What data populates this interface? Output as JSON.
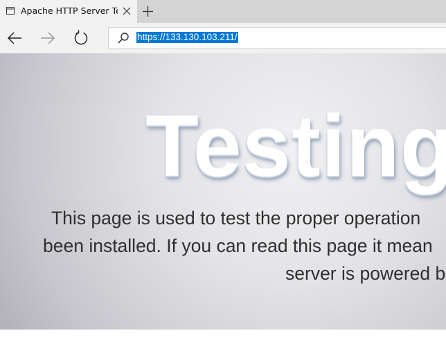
{
  "tab": {
    "title": "Apache HTTP Server Tes"
  },
  "address_bar": {
    "url": "https://133.130.103.211/"
  },
  "icons": {
    "tab": "page-icon",
    "close": "close-icon",
    "new_tab": "plus-icon",
    "back": "arrow-left-icon",
    "forward": "arrow-right-icon",
    "refresh": "refresh-icon",
    "address": "search-icon"
  },
  "page": {
    "heading": "Testing",
    "lines": [
      "This page is used to test the proper operation",
      "been installed. If you can read this page it mean",
      "server is powered b"
    ]
  },
  "colors": {
    "selection": "#0078d7",
    "tabstrip": "#d4d4d4",
    "toolbar": "#f2f2f2"
  }
}
